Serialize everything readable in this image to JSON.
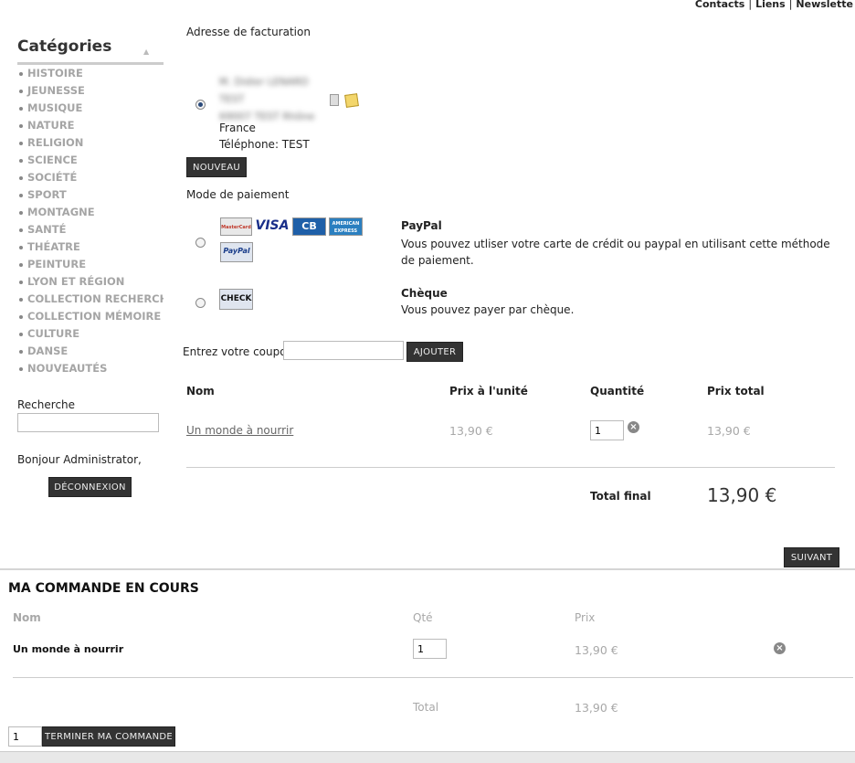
{
  "top_links": [
    "Contacts",
    "Liens",
    "Newslette"
  ],
  "sidebar": {
    "title": "Catégories",
    "categories": [
      "HISTOIRE",
      "JEUNESSE",
      "MUSIQUE",
      "NATURE",
      "RELIGION",
      "SCIENCE",
      "SOCIÉTÉ",
      "SPORT",
      "MONTAGNE",
      "SANTÉ",
      "THÉATRE",
      "PEINTURE",
      "LYON ET RÉGION",
      "COLLECTION RECHERCHES",
      "COLLECTION MÉMOIRE",
      "CULTURE",
      "DANSE",
      "NOUVEAUTÉS"
    ],
    "search_label": "Recherche",
    "search_value": "",
    "greeting": "Bonjour Administrator,",
    "logout_label": "DÉCONNEXION"
  },
  "billing": {
    "heading": "Adresse de facturation",
    "blurred_line1": "M. Didier LENARD",
    "blurred_line2": "TEST",
    "blurred_line3": "69007 TEST Rhône",
    "country": "France",
    "phone": "Téléphone: TEST",
    "new_label": "NOUVEAU"
  },
  "payment": {
    "heading": "Mode de paiement",
    "methods": [
      {
        "title": "PayPal",
        "description": "Vous pouvez utliser votre carte de crédit ou paypal en utilisant cette méthode de paiement.",
        "cards": [
          "MasterCard",
          "VISA",
          "CB",
          "AMERICAN EXPRESS",
          "PayPal"
        ]
      },
      {
        "title": "Chèque",
        "description": "Vous pouvez payer par chèque.",
        "cards": [
          "CHECK"
        ]
      }
    ]
  },
  "coupon": {
    "label": "Entrez votre coupon",
    "value": "",
    "button": "AJOUTER"
  },
  "cart_table": {
    "headers": [
      "Nom",
      "Prix à l'unité",
      "Quantité",
      "Prix total"
    ],
    "item": {
      "name": "Un monde à nourrir",
      "unit_price": "13,90 €",
      "quantity": "1",
      "total": "13,90 €"
    },
    "total_label": "Total final",
    "total_value": "13,90 €",
    "next_label": "SUIVANT"
  },
  "current_order": {
    "title": "MA COMMANDE EN COURS",
    "headers": [
      "Nom",
      "Qté",
      "Prix"
    ],
    "item": {
      "name": "Un monde à nourrir",
      "quantity": "1",
      "price": "13,90 €"
    },
    "total_label": "Total",
    "total_value": "13,90 €",
    "qty_value": "1",
    "finish_label": "TERMINER MA COMMANDE"
  },
  "colors": {
    "dark_button": "#333333",
    "muted_text": "#a8a8a8",
    "divider": "#cccccc"
  }
}
